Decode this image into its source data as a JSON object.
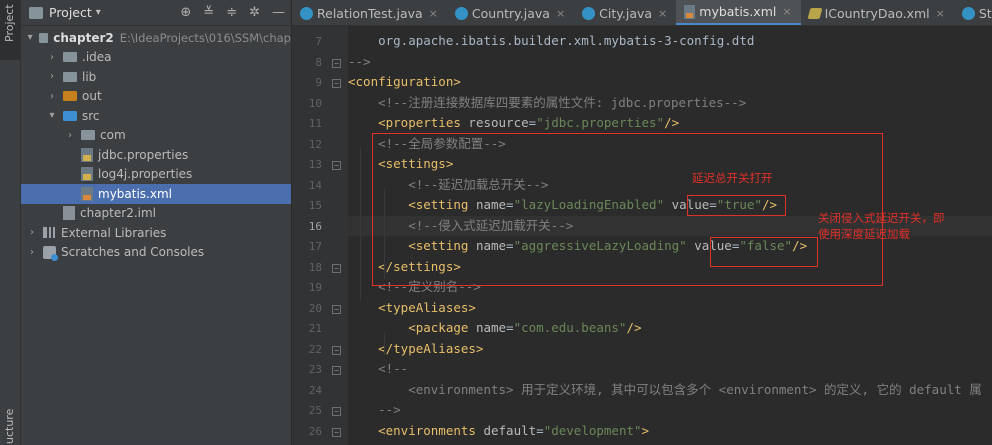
{
  "side_strip": {
    "project_tab": "Project",
    "structure_tab": "ucture"
  },
  "project_panel": {
    "title": "Project",
    "tree": [
      {
        "label": "chapter2",
        "hint": "E:\\IdeaProjects\\016\\SSM\\chap"
      },
      {
        "label": ".idea"
      },
      {
        "label": "lib"
      },
      {
        "label": "out"
      },
      {
        "label": "src"
      },
      {
        "label": "com"
      },
      {
        "label": "jdbc.properties"
      },
      {
        "label": "log4j.properties"
      },
      {
        "label": "mybatis.xml"
      },
      {
        "label": "chapter2.iml"
      },
      {
        "label": "External Libraries"
      },
      {
        "label": "Scratches and Consoles"
      }
    ]
  },
  "tabs": [
    {
      "label": "RelationTest.java"
    },
    {
      "label": "Country.java"
    },
    {
      "label": "City.java"
    },
    {
      "label": "mybatis.xml"
    },
    {
      "label": "ICountryDao.xml"
    },
    {
      "label": "Student.ja"
    }
  ],
  "editor": {
    "line_numbers": [
      "7",
      "8",
      "9",
      "10",
      "11",
      "12",
      "13",
      "14",
      "15",
      "16",
      "17",
      "18",
      "19",
      "20",
      "21",
      "22",
      "23",
      "24",
      "25",
      "26"
    ],
    "current_line": "16",
    "lines": [
      {
        "t": [
          [
            "text",
            "    org.apache.ibatis.builder.xml.mybatis-3-config.dtd"
          ]
        ]
      },
      {
        "t": [
          [
            "comment",
            "-->"
          ]
        ]
      },
      {
        "t": [
          [
            "tag",
            "<configuration>"
          ]
        ]
      },
      {
        "t": [
          [
            "comment",
            "    <!--注册连接数据库四要素的属性文件: jdbc.properties-->"
          ]
        ]
      },
      {
        "t": [
          [
            "tag",
            "    <properties "
          ],
          [
            "attr",
            "resource"
          ],
          [
            "text",
            "="
          ],
          [
            "val",
            "\"jdbc.properties\""
          ],
          [
            "tag",
            "/>"
          ]
        ]
      },
      {
        "t": [
          [
            "comment",
            "    <!--全局参数配置-->"
          ]
        ]
      },
      {
        "t": [
          [
            "tag",
            "    <settings>"
          ]
        ]
      },
      {
        "t": [
          [
            "comment",
            "        <!--延迟加载总开关-->"
          ]
        ]
      },
      {
        "t": [
          [
            "tag",
            "        <setting "
          ],
          [
            "attr",
            "name"
          ],
          [
            "text",
            "="
          ],
          [
            "val",
            "\"lazyLoadingEnabled\""
          ],
          [
            "text",
            " "
          ],
          [
            "attr",
            "value"
          ],
          [
            "text",
            "="
          ],
          [
            "val",
            "\"true\""
          ],
          [
            "tag",
            "/>"
          ]
        ]
      },
      {
        "t": [
          [
            "comment",
            "        <!--侵入式延迟加载开关-->"
          ]
        ]
      },
      {
        "t": [
          [
            "tag",
            "        <setting "
          ],
          [
            "attr",
            "name"
          ],
          [
            "text",
            "="
          ],
          [
            "val",
            "\"aggressiveLazyLoading\""
          ],
          [
            "text",
            " "
          ],
          [
            "attr",
            "value"
          ],
          [
            "text",
            "="
          ],
          [
            "val",
            "\"false\""
          ],
          [
            "tag",
            "/>"
          ]
        ]
      },
      {
        "t": [
          [
            "tag",
            "    </settings>"
          ]
        ]
      },
      {
        "t": [
          [
            "comment",
            "    <!--定义别名-->"
          ]
        ]
      },
      {
        "t": [
          [
            "tag",
            "    <typeAliases>"
          ]
        ]
      },
      {
        "t": [
          [
            "tag",
            "        <package "
          ],
          [
            "attr",
            "name"
          ],
          [
            "text",
            "="
          ],
          [
            "val",
            "\"com.edu.beans\""
          ],
          [
            "tag",
            "/>"
          ]
        ]
      },
      {
        "t": [
          [
            "tag",
            "    </typeAliases>"
          ]
        ]
      },
      {
        "t": [
          [
            "comment",
            "    <!--"
          ]
        ]
      },
      {
        "t": [
          [
            "comment",
            "        <environments> 用于定义环境, 其中可以包含多个 <environment> 的定义, 它的 default 属"
          ]
        ]
      },
      {
        "t": [
          [
            "comment",
            "    -->"
          ]
        ]
      },
      {
        "t": [
          [
            "tag",
            "    <environments "
          ],
          [
            "attr",
            "default"
          ],
          [
            "text",
            "="
          ],
          [
            "val",
            "\"development\""
          ],
          [
            "tag",
            ">"
          ]
        ]
      }
    ]
  },
  "annotations": {
    "note1": "延迟总开关打开",
    "note2_line1": "关闭侵入式延迟开关，即",
    "note2_line2": "使用深度延迟加载"
  },
  "colors": {
    "annotation_red": "#e0302a",
    "selection_blue": "#4b6eaf",
    "tag_yellow": "#e8bf6a",
    "string_green": "#6a8759",
    "comment_gray": "#808080"
  }
}
